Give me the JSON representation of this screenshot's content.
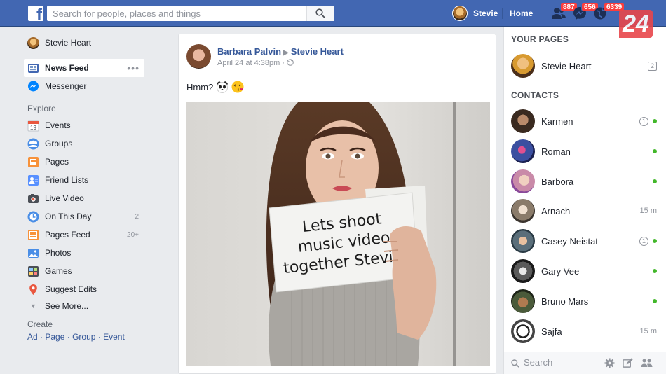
{
  "topbar": {
    "search_placeholder": "Search for people, places and things",
    "user_name": "Stevie",
    "home_label": "Home",
    "badges": {
      "friend_requests": "887",
      "messages": "656",
      "notifications": "6339"
    },
    "watermark": "24"
  },
  "leftnav": {
    "profile_name": "Stevie Heart",
    "items": [
      {
        "label": "News Feed",
        "icon": "news-feed-icon"
      },
      {
        "label": "Messenger",
        "icon": "messenger-icon"
      }
    ],
    "explore_title": "Explore",
    "explore": [
      {
        "label": "Events",
        "icon": "calendar-icon",
        "count": "",
        "icon_text": "19"
      },
      {
        "label": "Groups",
        "icon": "groups-icon",
        "count": ""
      },
      {
        "label": "Pages",
        "icon": "flag-icon",
        "count": ""
      },
      {
        "label": "Friend Lists",
        "icon": "friend-list-icon",
        "count": ""
      },
      {
        "label": "Live Video",
        "icon": "camera-icon",
        "count": ""
      },
      {
        "label": "On This Day",
        "icon": "clock-icon",
        "count": "2"
      },
      {
        "label": "Pages Feed",
        "icon": "pages-feed-icon",
        "count": "20+"
      },
      {
        "label": "Photos",
        "icon": "photos-icon",
        "count": ""
      },
      {
        "label": "Games",
        "icon": "games-icon",
        "count": ""
      },
      {
        "label": "Suggest Edits",
        "icon": "map-pin-icon",
        "count": ""
      }
    ],
    "see_more": "See More...",
    "create_title": "Create",
    "create_links": [
      "Ad",
      "Page",
      "Group",
      "Event"
    ]
  },
  "post": {
    "author": "Barbara Palvin",
    "target": "Stevie Heart",
    "timestamp": "April 24 at 4:38pm",
    "separator": "·",
    "text": "Hmm?",
    "sign_text": [
      "Lets shoot",
      "music video",
      "together Stevie!"
    ]
  },
  "rightbar": {
    "pages_title": "YOUR PAGES",
    "page": {
      "name": "Stevie Heart",
      "count": "2"
    },
    "contacts_title": "CONTACTS",
    "contacts": [
      {
        "name": "Karmen",
        "badge": "1",
        "status": "online",
        "time": "",
        "color": "#3a2a20"
      },
      {
        "name": "Roman",
        "badge": "",
        "status": "online",
        "time": "",
        "color": "#3b4fa0"
      },
      {
        "name": "Barbora",
        "badge": "",
        "status": "online",
        "time": "",
        "color": "#c98aa8"
      },
      {
        "name": "Arnach",
        "badge": "",
        "status": "away",
        "time": "15 m",
        "color": "#8a7b6a"
      },
      {
        "name": "Casey Neistat",
        "badge": "1",
        "status": "online",
        "time": "",
        "color": "#5a6e7a"
      },
      {
        "name": "Gary Vee",
        "badge": "",
        "status": "online",
        "time": "",
        "color": "#2b2b2b"
      },
      {
        "name": "Bruno Mars",
        "badge": "",
        "status": "online",
        "time": "",
        "color": "#4a5a3a"
      },
      {
        "name": "Sajfa",
        "badge": "",
        "status": "away",
        "time": "15 m",
        "color": "#e0e0e0"
      }
    ],
    "search_placeholder": "Search"
  }
}
